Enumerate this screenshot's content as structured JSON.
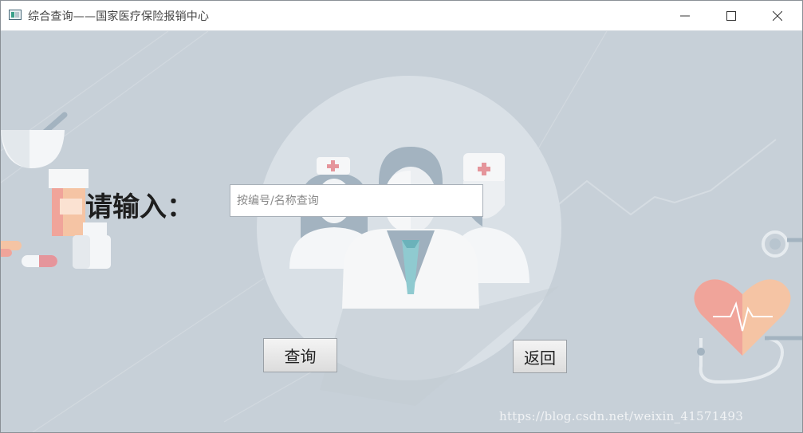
{
  "window": {
    "title": "综合查询——国家医疗保险报销中心",
    "minimize_glyph": "—",
    "maximize_glyph": "☐",
    "close_glyph": "✕"
  },
  "form": {
    "prompt_label": "请输入：",
    "search_placeholder": "按编号/名称查询",
    "search_value": "",
    "query_button_label": "查询",
    "back_button_label": "返回"
  },
  "watermark": "https://blog.csdn.net/weixin_41571493",
  "colors": {
    "background": "#c7d0d8",
    "circle": "#d9e0e6",
    "accent_pink": "#f0a49a",
    "accent_peach": "#f5c4a4"
  },
  "icons": [
    "app-window-icon",
    "minimize-icon",
    "maximize-icon",
    "close-icon",
    "doctor-group-illustration",
    "medicine-bottle-icon",
    "pill-capsule-icon",
    "mortar-bowl-icon",
    "heart-stethoscope-icon",
    "heartbeat-line-icon"
  ]
}
